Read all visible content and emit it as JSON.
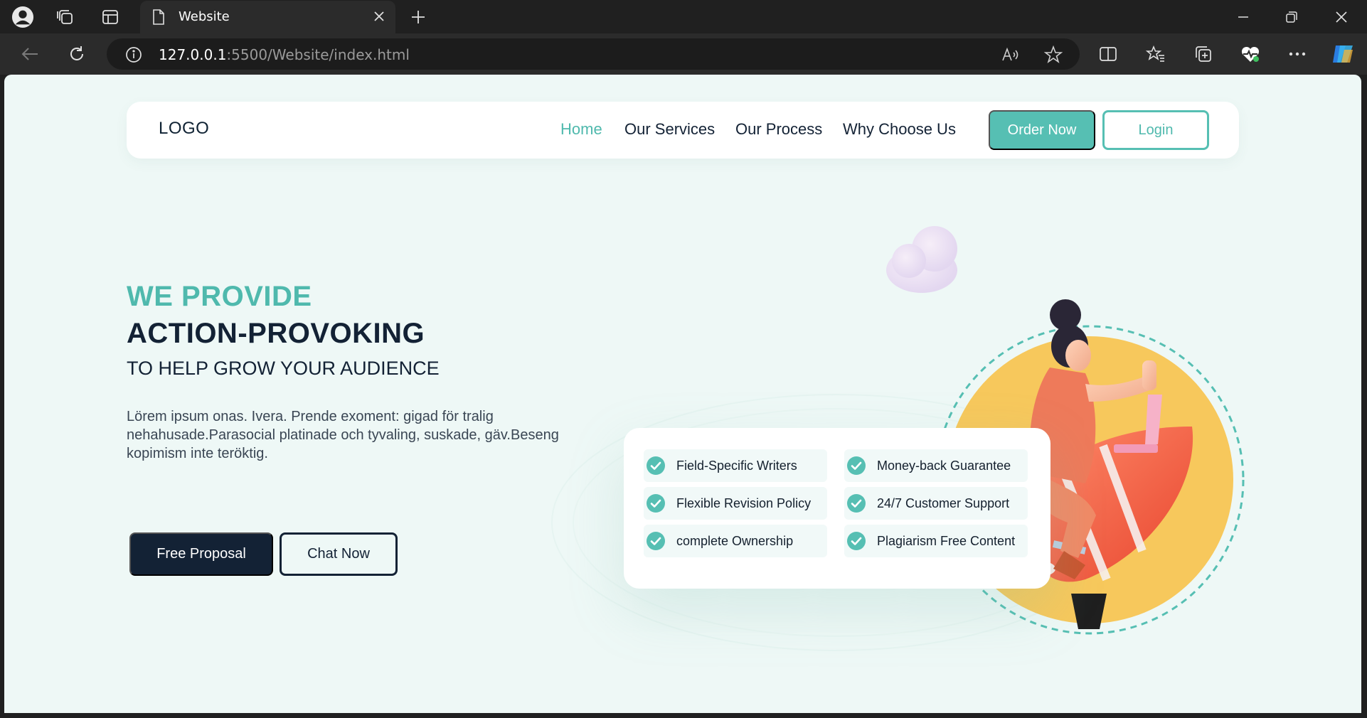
{
  "browser": {
    "tab_title": "Website",
    "url_host": "127.0.0.1",
    "url_rest": ":5500/Website/index.html"
  },
  "nav": {
    "logo": "LOGO",
    "links": [
      "Home",
      "Our Services",
      "Our Process",
      "Why Choose Us"
    ],
    "active_link": "Home",
    "order_label": "Order Now",
    "login_label": "Login"
  },
  "hero": {
    "kicker": "WE PROVIDE",
    "title": "ACTION-PROVOKING",
    "subtitle": "TO HELP GROW YOUR AUDIENCE",
    "paragraph": "Lörem ipsum onas. Ivera. Prende exoment: gigad för tralig nehahusade.Parasocial platinade och tyvaling, suskade, gäv.Beseng kopimism inte teröktig.",
    "primary_button": "Free Proposal",
    "secondary_button": "Chat Now"
  },
  "features": [
    "Field-Specific Writers",
    "Money-back Guarantee",
    "Flexible Revision Policy",
    "24/7 Customer Support",
    "complete Ownership",
    "Plagiarism Free Content"
  ],
  "colors": {
    "accent": "#56bfb3",
    "dark": "#132235",
    "background": "#eef8f6",
    "illustration_circle": "#f7c85c"
  }
}
